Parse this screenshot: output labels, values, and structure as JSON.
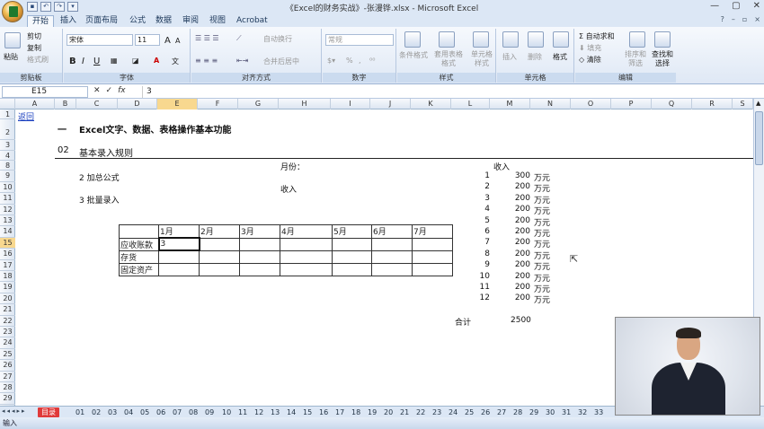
{
  "window": {
    "title": "《Excel的财务实战》-张漫铧.xlsx - Microsoft Excel",
    "controls": [
      "—",
      "▢",
      "✕"
    ]
  },
  "ribbon_tabs": [
    "开始",
    "插入",
    "页面布局",
    "公式",
    "数据",
    "审阅",
    "视图",
    "Acrobat"
  ],
  "active_tab": "开始",
  "ribbon": {
    "clipboard": {
      "paste": "粘贴",
      "cut": "剪切",
      "copy": "复制",
      "format_painter": "格式刷",
      "label": "剪贴板"
    },
    "font": {
      "font_name": "宋体",
      "font_size": "11",
      "bold": "B",
      "italic": "I",
      "underline": "U",
      "grow": "A",
      "shrink": "A",
      "label": "字体"
    },
    "alignment": {
      "wrap": "自动换行",
      "merge": "合并后居中",
      "label": "对齐方式"
    },
    "number": {
      "format": "常规",
      "percent": "%",
      "comma": ",",
      "label": "数字"
    },
    "styles": {
      "conditional": "条件格式",
      "table": "套用表格格式",
      "cell": "单元格样式",
      "label": "样式"
    },
    "cells": {
      "insert": "插入",
      "delete": "删除",
      "format": "格式",
      "label": "单元格"
    },
    "editing": {
      "autosum": "自动求和",
      "fill": "填充",
      "clear": "清除",
      "sort": "排序和筛选",
      "find": "查找和选择",
      "label": "编辑"
    }
  },
  "formula_bar": {
    "name_box": "E15",
    "value": "3"
  },
  "columns": [
    "A",
    "B",
    "C",
    "D",
    "E",
    "F",
    "G",
    "H",
    "I",
    "J",
    "K",
    "L",
    "M",
    "N",
    "O",
    "P",
    "Q",
    "R",
    "S"
  ],
  "rows": [
    "1",
    "2",
    "3",
    "4",
    "5",
    "6",
    "7",
    "8",
    "9",
    "10",
    "11",
    "12",
    "13",
    "14",
    "15",
    "16",
    "17",
    "18",
    "19",
    "20",
    "21",
    "22",
    "23",
    "24",
    "25",
    "26",
    "27",
    "28",
    "29"
  ],
  "selected_cell": {
    "col": "E",
    "row": "15"
  },
  "cells": {
    "link": "返回",
    "heading_num": "一",
    "heading": "Excel文字、数据、表格操作基本功能",
    "section_num": "02",
    "section": "基本录入规则",
    "month_label": "月份：",
    "income_label_right": "收入",
    "item2": "2  加总公式",
    "income_label_mid": "收入",
    "item3": "3  批量录入",
    "total_label": "合计",
    "total_value": "2500"
  },
  "month_table": {
    "headers": [
      "",
      "1月",
      "2月",
      "3月",
      "4月",
      "5月",
      "6月",
      "7月"
    ],
    "rows": [
      [
        "应收账款",
        "3",
        "",
        "",
        "",
        "",
        "",
        ""
      ],
      [
        "存货",
        "",
        "",
        "",
        "",
        "",
        "",
        ""
      ],
      [
        "固定资产",
        "",
        "",
        "",
        "",
        "",
        "",
        ""
      ]
    ]
  },
  "income_list": [
    {
      "n": "1",
      "v": "300",
      "u": "万元"
    },
    {
      "n": "2",
      "v": "200",
      "u": "万元"
    },
    {
      "n": "3",
      "v": "200",
      "u": "万元"
    },
    {
      "n": "4",
      "v": "200",
      "u": "万元"
    },
    {
      "n": "5",
      "v": "200",
      "u": "万元"
    },
    {
      "n": "6",
      "v": "200",
      "u": "万元"
    },
    {
      "n": "7",
      "v": "200",
      "u": "万元"
    },
    {
      "n": "8",
      "v": "200",
      "u": "万元"
    },
    {
      "n": "9",
      "v": "200",
      "u": "万元"
    },
    {
      "n": "10",
      "v": "200",
      "u": "万元"
    },
    {
      "n": "11",
      "v": "200",
      "u": "万元"
    },
    {
      "n": "12",
      "v": "200",
      "u": "万元"
    }
  ],
  "sheet_tabs": [
    "目录",
    "01",
    "02",
    "03",
    "04",
    "05",
    "06",
    "07",
    "08",
    "09",
    "10",
    "11",
    "12",
    "13",
    "14",
    "15",
    "16",
    "17",
    "18",
    "19",
    "20",
    "21",
    "22",
    "23",
    "24",
    "25",
    "26",
    "27",
    "28",
    "29",
    "30",
    "31",
    "32",
    "33"
  ],
  "active_sheet": "目录",
  "status": "输入"
}
